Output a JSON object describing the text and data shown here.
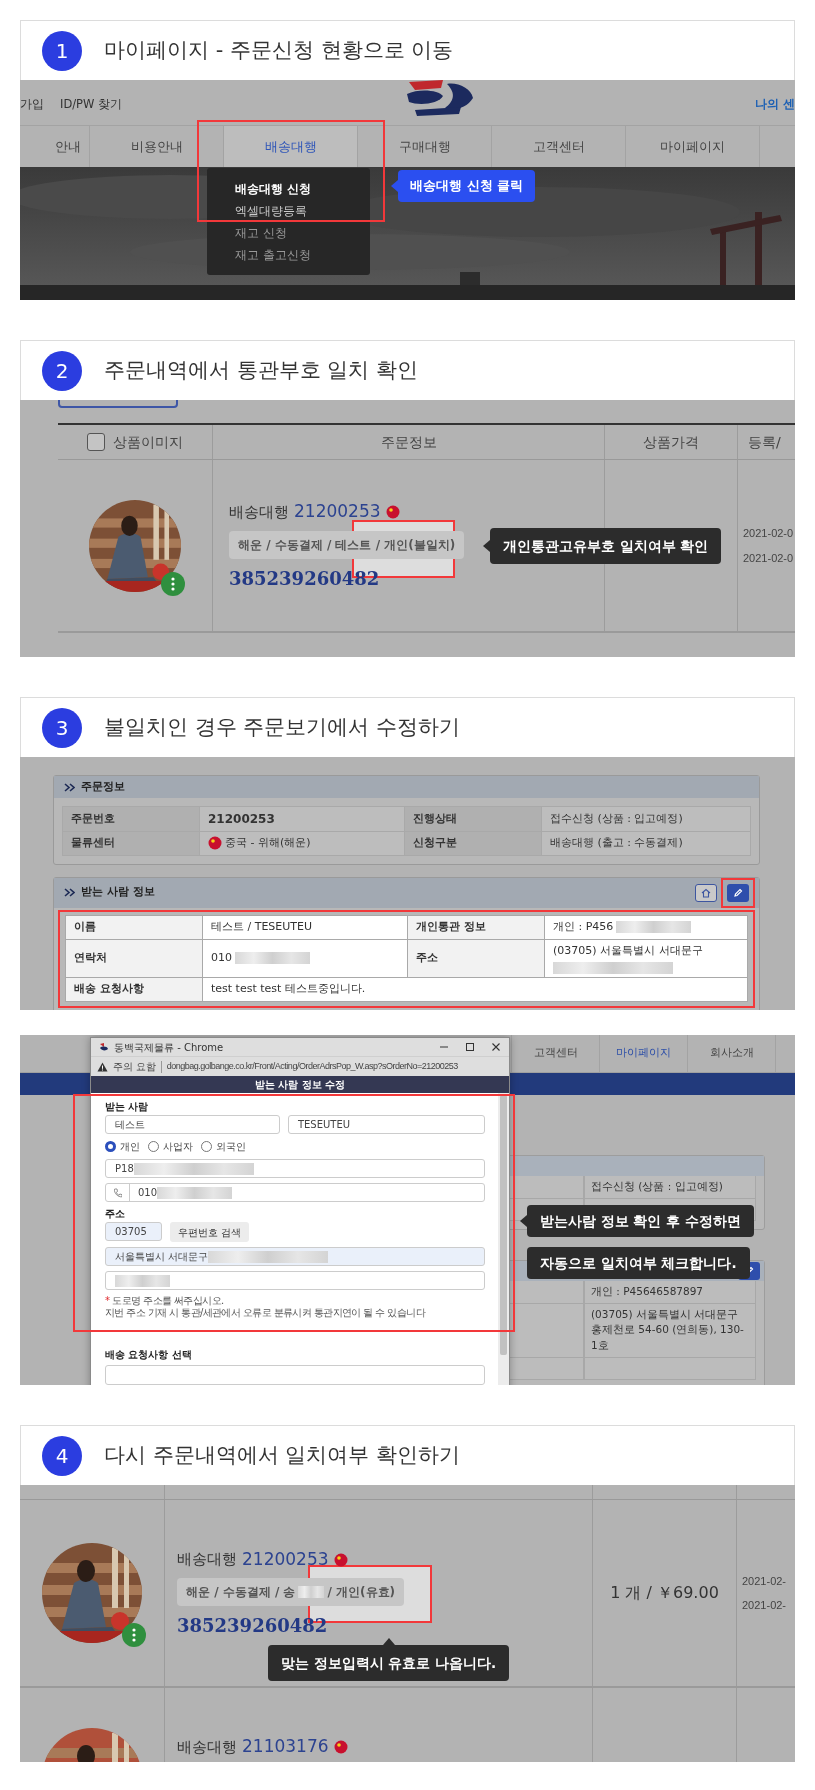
{
  "steps": [
    {
      "number": "1",
      "title": "마이페이지 - 주문신청 현황으로 이동",
      "screen": {
        "kind": "menu",
        "top_links": [
          "가입",
          "ID/PW 찾기"
        ],
        "top_right": "나의 센",
        "nav": [
          {
            "label": "안내",
            "selected": false
          },
          {
            "label": "비용안내",
            "selected": false
          },
          {
            "label": "배송대행",
            "selected": true
          },
          {
            "label": "구매대행",
            "selected": false
          },
          {
            "label": "고객센터",
            "selected": false
          },
          {
            "label": "마이페이지",
            "selected": false
          }
        ],
        "dropdown": [
          {
            "label": "배송대행 신청",
            "selected": true
          },
          {
            "label": "엑셀대량등록",
            "selected": false
          },
          {
            "label": "재고 신청",
            "selected": false
          },
          {
            "label": "재고 출고신청",
            "selected": false
          }
        ],
        "callout": "배송대행 신청 클릭"
      }
    },
    {
      "number": "2",
      "title": "주문내역에서 통관부호 일치 확인",
      "screen": {
        "kind": "orders",
        "header_checked": false,
        "columns": [
          "상품이미지",
          "주문정보",
          "상품가격",
          "등록/"
        ],
        "rows": [
          {
            "type_label": "배송대행",
            "order_no": "21200253",
            "tag": [
              "해운 / 수동결제 / 테스트 / 개인(불일치)"
            ],
            "tracking": "385239260482",
            "dates": [
              "2021-02-0",
              "2021-02-0"
            ]
          }
        ],
        "callout": "개인통관고유부호 일치여부 확인"
      }
    },
    {
      "number": "3",
      "title": "불일치인 경우 주문보기에서 수정하기",
      "screen": {
        "kind": "detail",
        "panels": [
          {
            "title": "주문정보",
            "highlighted": false,
            "rows": [
              [
                {
                  "kind": "head",
                  "text": "주문번호"
                },
                {
                  "kind": "value",
                  "text": "21200253",
                  "bold": true
                },
                {
                  "kind": "head",
                  "text": "진행상태"
                },
                {
                  "kind": "value",
                  "text": "접수신청 (상품 : 입고예정)"
                }
              ],
              [
                {
                  "kind": "head",
                  "text": "물류센터"
                },
                {
                  "kind": "value",
                  "text": "중국 - 위해(해운)",
                  "flag": true
                },
                {
                  "kind": "head",
                  "text": "신청구분"
                },
                {
                  "kind": "value",
                  "text": "배송대행 (출고 : 수동결제)"
                }
              ]
            ]
          },
          {
            "title": "받는 사람 정보",
            "highlighted": true,
            "buttons": [
              {
                "kind": "home",
                "highlighted": false
              },
              {
                "kind": "edit",
                "highlighted": true
              }
            ],
            "rows": [
              [
                {
                  "kind": "head",
                  "text": "이름"
                },
                {
                  "kind": "value",
                  "text": "테스트 / TESEUTEU"
                },
                {
                  "kind": "head",
                  "text": "개인통관 정보"
                },
                {
                  "kind": "value",
                  "text": "개인 : P456",
                  "redacted": true
                }
              ],
              [
                {
                  "kind": "head",
                  "text": "연락처"
                },
                {
                  "kind": "value",
                  "text": "010",
                  "redacted": true
                },
                {
                  "kind": "head",
                  "text": "주소"
                },
                {
                  "kind": "value",
                  "text": "(03705) 서울특별시 서대문구",
                  "redacted": true
                }
              ],
              [
                {
                  "kind": "head",
                  "text": "배송 요청사항"
                },
                {
                  "kind": "value",
                  "text": "test test test 테스트중입니다.",
                  "wide": true
                }
              ]
            ]
          }
        ]
      }
    },
    {
      "screen": {
        "kind": "popup",
        "background_nav": [
          {
            "label": "고객센터",
            "selected": false
          },
          {
            "label": "마이페이지",
            "selected": true
          },
          {
            "label": "회사소개",
            "selected": false
          }
        ],
        "background_texts": [
          "접수신청 (상품 : 입고예정)",
          "개인 : P45646587897",
          "(03705) 서울특별시 서대문구 홍제천로 54-60 (연희동), 130-1호"
        ],
        "window": {
          "title": "동백국제물류 - Chrome",
          "warning": "주의 요함",
          "url": "dongbag.golbange.co.kr/Front/Acting/OrderAdrsPop_W.asp?sOrderNo=21200253",
          "header": "받는 사람 정보 수정",
          "recipient_label": "받는 사람",
          "name_fields": [
            "테스트",
            "TESEUTEU"
          ],
          "radios": [
            {
              "label": "개인",
              "selected": true
            },
            {
              "label": "사업자",
              "selected": false
            },
            {
              "label": "외국인",
              "selected": false
            }
          ],
          "customs_field": {
            "value": "P18",
            "redacted": true
          },
          "phone_field": {
            "value": "010",
            "redacted": true
          },
          "address_label": "주소",
          "zip": "03705",
          "zip_button": "우편번호 검색",
          "address_field": {
            "value": "서울특별시 서대문구",
            "redacted": true
          },
          "detail_field": {
            "redacted": true
          },
          "required_mark": "*",
          "notes": [
            "도로명 주소를 써주십시오.",
            "지번 주소 기재 시 통관/세관에서 오류로 분류시켜 통관지연이 될 수 있습니다"
          ],
          "request_label": "배송 요청사항 선택"
        },
        "callouts": [
          "받는사람 정보 확인 후 수정하면",
          "자동으로 일치여부 체크합니다."
        ]
      }
    },
    {
      "number": "4",
      "title": "다시 주문내역에서 일치여부 확인하기",
      "screen": {
        "kind": "orders_zoomed",
        "rows": [
          {
            "type_label": "배송대행",
            "order_no": "21200253",
            "tag": [
              "해운 / 수동결제 / 송",
              "/ 개인(유효)"
            ],
            "tracking": "385239260482",
            "price": "1 개 / ￥69.00",
            "dates": [
              "2021-02-",
              "2021-02-"
            ]
          },
          {
            "type_label": "배송대행",
            "order_no": "21103176"
          }
        ],
        "callout": "맞는 정보입력시 유효로 나옵니다."
      }
    }
  ]
}
